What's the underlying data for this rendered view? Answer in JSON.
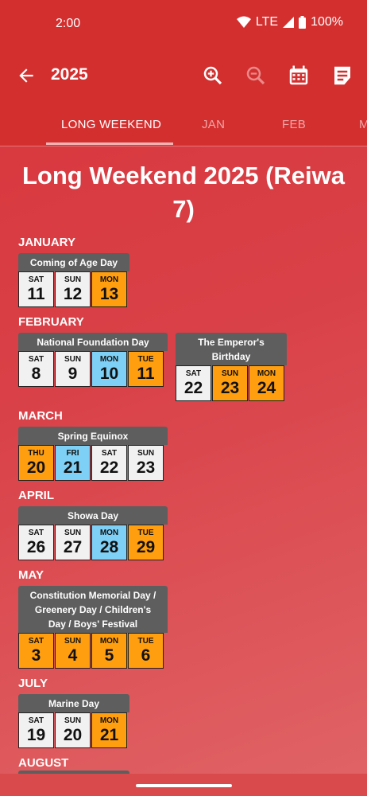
{
  "status_bar": {
    "time": "2:00",
    "network": "LTE",
    "battery": "100%"
  },
  "app_bar": {
    "title": "2025",
    "icons": [
      "arrow-back-icon",
      "zoom-in-icon",
      "zoom-out-icon",
      "calendar-icon",
      "note-icon"
    ]
  },
  "tabs": [
    {
      "label": "LONG WEEKEND",
      "active": true
    },
    {
      "label": "JAN",
      "active": false
    },
    {
      "label": "FEB",
      "active": false
    },
    {
      "label": "M",
      "active": false
    }
  ],
  "page": {
    "title_line1": "Long Weekend 2025 (Reiwa",
    "title_line2": "7)"
  },
  "months": [
    {
      "label": "JANUARY",
      "holidays": [
        {
          "name": "Coming of Age Day",
          "days": [
            {
              "dow": "SAT",
              "num": "11",
              "kind": "weekend"
            },
            {
              "dow": "SUN",
              "num": "12",
              "kind": "weekend"
            },
            {
              "dow": "MON",
              "num": "13",
              "kind": "holiday"
            }
          ]
        }
      ]
    },
    {
      "label": "FEBRUARY",
      "holidays": [
        {
          "name": "National Foundation Day",
          "days": [
            {
              "dow": "SAT",
              "num": "8",
              "kind": "weekend"
            },
            {
              "dow": "SUN",
              "num": "9",
              "kind": "weekend"
            },
            {
              "dow": "MON",
              "num": "10",
              "kind": "bridge"
            },
            {
              "dow": "TUE",
              "num": "11",
              "kind": "holiday"
            }
          ]
        },
        {
          "name": "The Emperor's Birthday",
          "days": [
            {
              "dow": "SAT",
              "num": "22",
              "kind": "weekend"
            },
            {
              "dow": "SUN",
              "num": "23",
              "kind": "holiday"
            },
            {
              "dow": "MON",
              "num": "24",
              "kind": "holiday"
            }
          ]
        }
      ]
    },
    {
      "label": "MARCH",
      "holidays": [
        {
          "name": "Spring Equinox",
          "days": [
            {
              "dow": "THU",
              "num": "20",
              "kind": "holiday"
            },
            {
              "dow": "FRI",
              "num": "21",
              "kind": "bridge"
            },
            {
              "dow": "SAT",
              "num": "22",
              "kind": "weekend"
            },
            {
              "dow": "SUN",
              "num": "23",
              "kind": "weekend"
            }
          ]
        }
      ]
    },
    {
      "label": "APRIL",
      "holidays": [
        {
          "name": "Showa Day",
          "days": [
            {
              "dow": "SAT",
              "num": "26",
              "kind": "weekend"
            },
            {
              "dow": "SUN",
              "num": "27",
              "kind": "weekend"
            },
            {
              "dow": "MON",
              "num": "28",
              "kind": "bridge"
            },
            {
              "dow": "TUE",
              "num": "29",
              "kind": "holiday"
            }
          ]
        }
      ]
    },
    {
      "label": "MAY",
      "holidays": [
        {
          "name_lines": [
            "Constitution Memorial Day /",
            "Greenery Day / Children's",
            "Day / Boys' Festival"
          ],
          "days": [
            {
              "dow": "SAT",
              "num": "3",
              "kind": "holiday"
            },
            {
              "dow": "SUN",
              "num": "4",
              "kind": "holiday"
            },
            {
              "dow": "MON",
              "num": "5",
              "kind": "holiday"
            },
            {
              "dow": "TUE",
              "num": "6",
              "kind": "holiday"
            }
          ]
        }
      ]
    },
    {
      "label": "JULY",
      "holidays": [
        {
          "name": "Marine Day",
          "days": [
            {
              "dow": "SAT",
              "num": "19",
              "kind": "weekend"
            },
            {
              "dow": "SUN",
              "num": "20",
              "kind": "weekend"
            },
            {
              "dow": "MON",
              "num": "21",
              "kind": "holiday"
            }
          ]
        }
      ]
    },
    {
      "label": "AUGUST",
      "holidays": []
    }
  ],
  "colors": {
    "appbar": "#d32f2f",
    "holiday": "#ff9e0f",
    "bridge": "#7fd0f6",
    "weekend": "#f1f1f1",
    "title_bar": "#5e5e5e"
  }
}
